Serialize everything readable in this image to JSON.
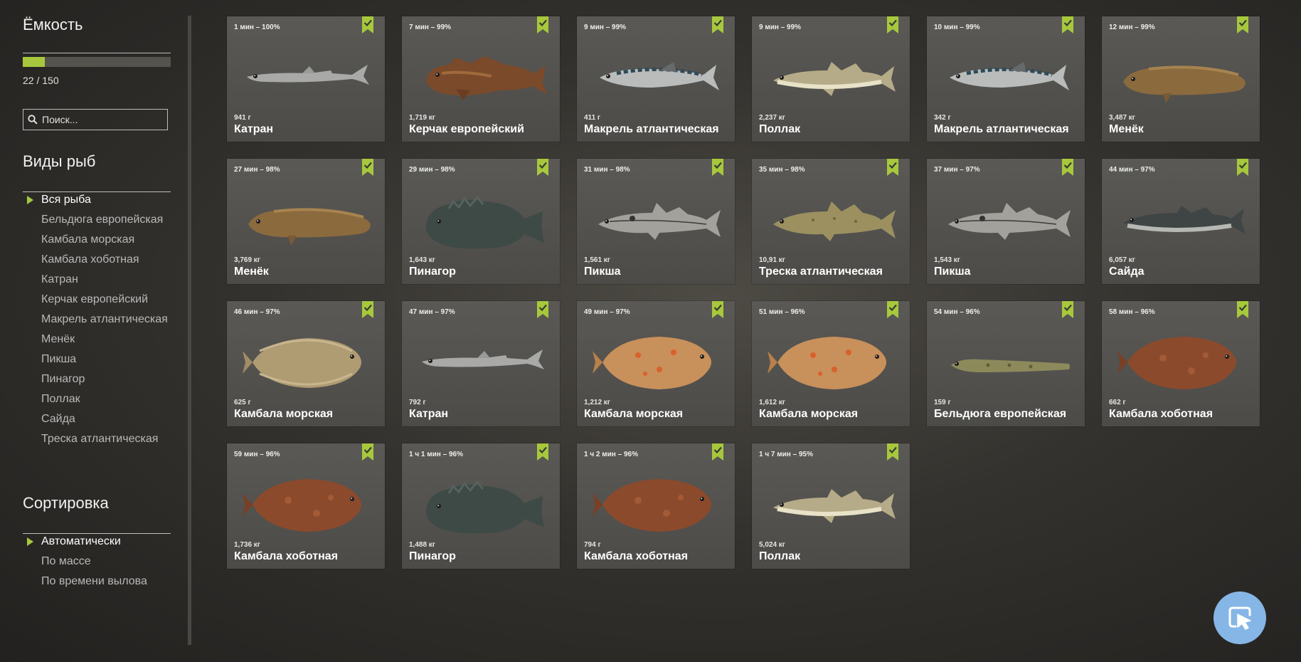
{
  "capacity": {
    "title": "Ёмкость",
    "current": 22,
    "max": 150,
    "text": "22 / 150",
    "fill_fraction": 0.147,
    "bar_color": "#a7c83c"
  },
  "search": {
    "placeholder": "Поиск..."
  },
  "species": {
    "title": "Виды рыб",
    "items": [
      {
        "label": "Вся рыба",
        "active": true
      },
      {
        "label": "Бельдюга европейская",
        "active": false
      },
      {
        "label": "Камбала морская",
        "active": false
      },
      {
        "label": "Камбала хоботная",
        "active": false
      },
      {
        "label": "Катран",
        "active": false
      },
      {
        "label": "Керчак европейский",
        "active": false
      },
      {
        "label": "Макрель атлантическая",
        "active": false
      },
      {
        "label": "Менёк",
        "active": false
      },
      {
        "label": "Пикша",
        "active": false
      },
      {
        "label": "Пинагор",
        "active": false
      },
      {
        "label": "Поллак",
        "active": false
      },
      {
        "label": "Сайда",
        "active": false
      },
      {
        "label": "Треска атлантическая",
        "active": false
      }
    ]
  },
  "sorting": {
    "title": "Сортировка",
    "items": [
      {
        "label": "Автоматически",
        "active": true
      },
      {
        "label": "По массе",
        "active": false
      },
      {
        "label": "По времени вылова",
        "active": false
      }
    ]
  },
  "catches": [
    {
      "time": "1 мин – 100%",
      "weight": "941 г",
      "name": "Катран",
      "kind": "shark"
    },
    {
      "time": "7 мин – 99%",
      "weight": "1,719 кг",
      "name": "Керчак европейский",
      "kind": "sculpin"
    },
    {
      "time": "9 мин – 99%",
      "weight": "411 г",
      "name": "Макрель атлантическая",
      "kind": "mackerel"
    },
    {
      "time": "9 мин – 99%",
      "weight": "2,237 кг",
      "name": "Поллак",
      "kind": "pollack"
    },
    {
      "time": "10 мин – 99%",
      "weight": "342 г",
      "name": "Макрель атлантическая",
      "kind": "mackerel"
    },
    {
      "time": "12 мин – 99%",
      "weight": "3,487 кг",
      "name": "Менёк",
      "kind": "tusk"
    },
    {
      "time": "27 мин – 98%",
      "weight": "3,769 кг",
      "name": "Менёк",
      "kind": "tusk"
    },
    {
      "time": "29 мин – 98%",
      "weight": "1,643 кг",
      "name": "Пинагор",
      "kind": "lumpfish"
    },
    {
      "time": "31 мин – 98%",
      "weight": "1,561 кг",
      "name": "Пикша",
      "kind": "haddock"
    },
    {
      "time": "35 мин – 98%",
      "weight": "10,91 кг",
      "name": "Треска атлантическая",
      "kind": "cod"
    },
    {
      "time": "37 мин – 97%",
      "weight": "1,543 кг",
      "name": "Пикша",
      "kind": "haddock"
    },
    {
      "time": "44 мин – 97%",
      "weight": "6,057 кг",
      "name": "Сайда",
      "kind": "saithe"
    },
    {
      "time": "46 мин – 97%",
      "weight": "625 г",
      "name": "Камбала морская",
      "kind": "flounder_pale"
    },
    {
      "time": "47 мин – 97%",
      "weight": "792 г",
      "name": "Катран",
      "kind": "shark"
    },
    {
      "time": "49 мин – 97%",
      "weight": "1,212 кг",
      "name": "Камбала морская",
      "kind": "plaice"
    },
    {
      "time": "51 мин – 96%",
      "weight": "1,612 кг",
      "name": "Камбала морская",
      "kind": "plaice"
    },
    {
      "time": "54 мин – 96%",
      "weight": "159 г",
      "name": "Бельдюга европейская",
      "kind": "eelpout"
    },
    {
      "time": "58 мин – 96%",
      "weight": "662 г",
      "name": "Камбала хоботная",
      "kind": "dab"
    },
    {
      "time": "59 мин – 96%",
      "weight": "1,736 кг",
      "name": "Камбала хоботная",
      "kind": "dab"
    },
    {
      "time": "1 ч 1 мин – 96%",
      "weight": "1,488 кг",
      "name": "Пинагор",
      "kind": "lumpfish"
    },
    {
      "time": "1 ч 2 мин – 96%",
      "weight": "794 г",
      "name": "Камбала хоботная",
      "kind": "dab"
    },
    {
      "time": "1 ч 7 мин – 95%",
      "weight": "5,024 кг",
      "name": "Поллак",
      "kind": "pollack"
    }
  ],
  "icons": {
    "check_flag": "check-flag-icon",
    "cursor_button": "cursor-select-icon",
    "search": "search-icon"
  },
  "colors": {
    "accent": "#a7c83c",
    "cursor_button": "#86b6e6"
  }
}
